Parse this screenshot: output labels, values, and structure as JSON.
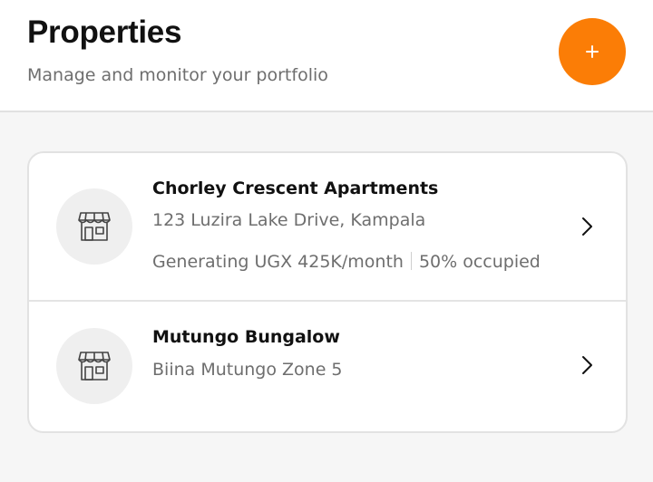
{
  "header": {
    "title": "Properties",
    "subtitle": "Manage and monitor your portfolio",
    "add_button_icon": "plus-icon"
  },
  "properties": [
    {
      "name": "Chorley Crescent Apartments",
      "address": "123 Luzira Lake Drive, Kampala",
      "income": "Generating UGX 425K/month",
      "occupancy": "50% occupied",
      "icon": "storefront-icon"
    },
    {
      "name": "Mutungo Bungalow",
      "address": "Biina Mutungo Zone 5",
      "icon": "storefront-icon"
    }
  ],
  "colors": {
    "accent": "#fb7d06",
    "background": "#f6f6f6",
    "card": "#ffffff",
    "muted_text": "#6e6e6e"
  }
}
